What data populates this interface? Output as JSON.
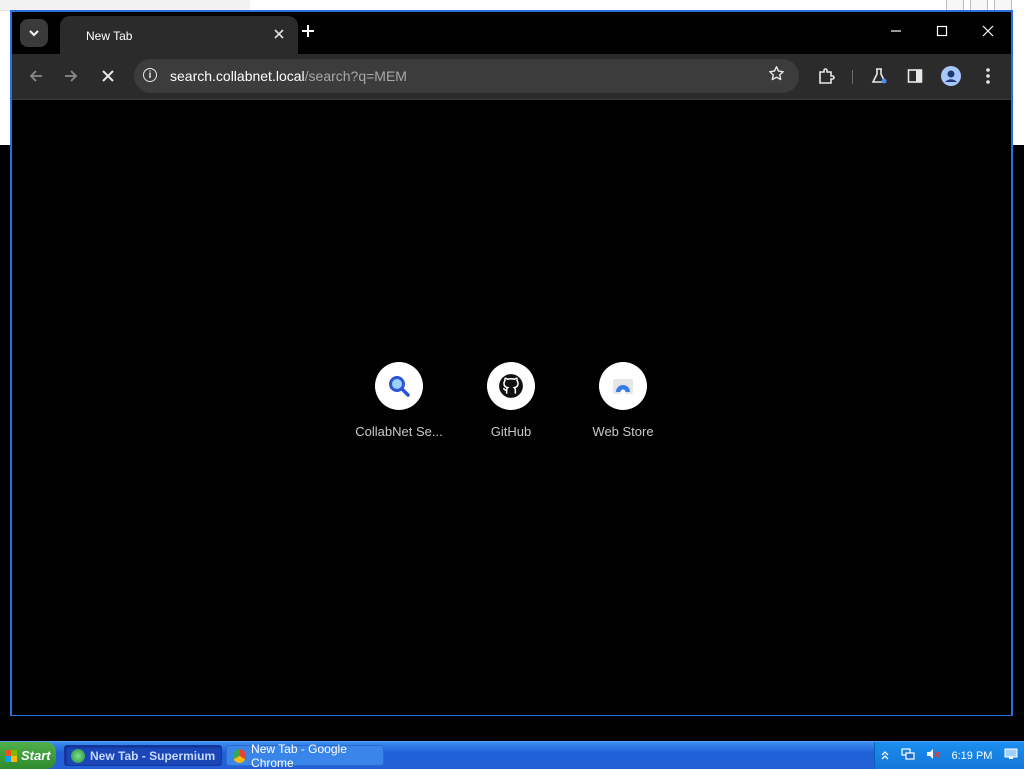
{
  "browser": {
    "tab_title": "New Tab",
    "url_host": "search.collabnet.local",
    "url_path": "/search?q=MEM",
    "info_icon_glyph": "i"
  },
  "shortcuts": [
    {
      "label": "CollabNet Se...",
      "icon": "search-icon"
    },
    {
      "label": "GitHub",
      "icon": "github-icon"
    },
    {
      "label": "Web Store",
      "icon": "web-store-icon"
    }
  ],
  "taskbar": {
    "start_label": "Start",
    "tasks": [
      {
        "label": "New Tab - Supermium",
        "active": true
      },
      {
        "label": "New Tab - Google Chrome",
        "active": false
      }
    ],
    "clock": "6:19 PM"
  },
  "colors": {
    "window_border": "#2c6de0",
    "toolbar_bg": "#2b2b2b",
    "taskbar_blue": "#2461d6",
    "start_green": "#3fa03b"
  }
}
